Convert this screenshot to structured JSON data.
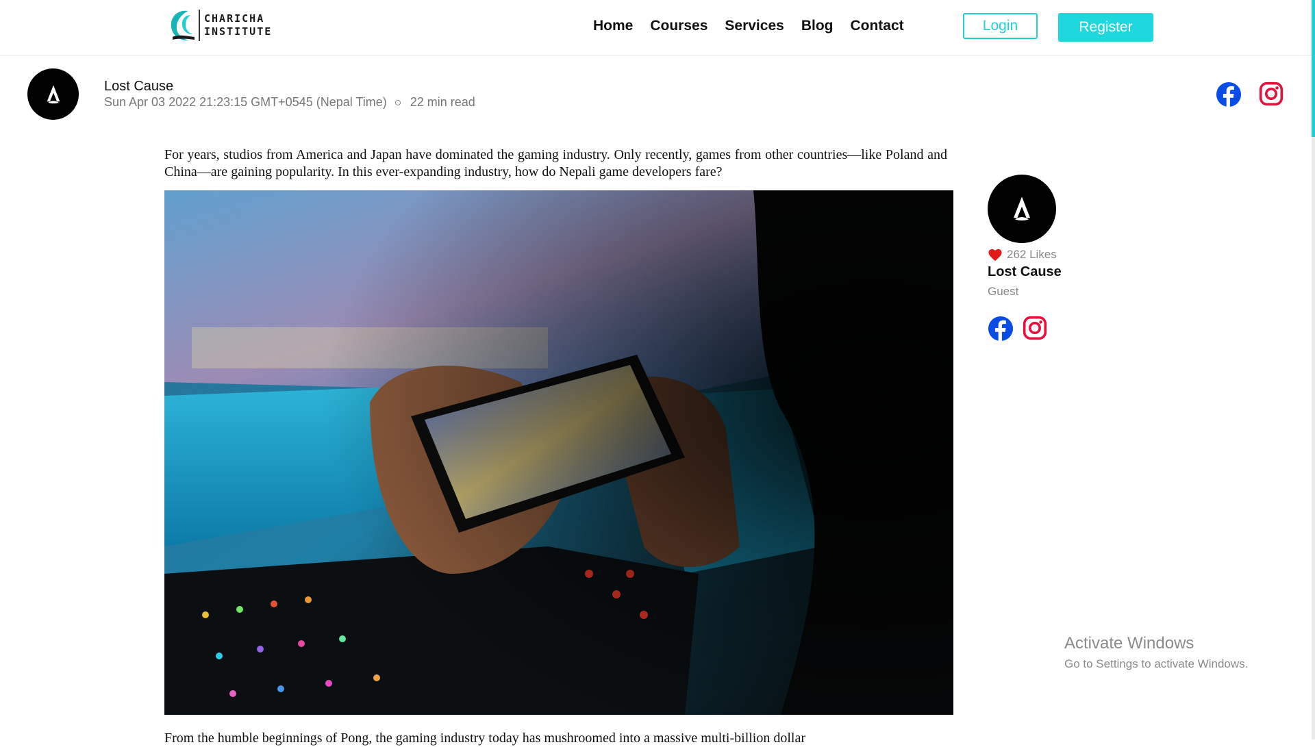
{
  "brand": {
    "line1": "CHARICHA",
    "line2": "INSTITUTE",
    "accent": "#1fd8de"
  },
  "nav": {
    "items": [
      "Home",
      "Courses",
      "Services",
      "Blog",
      "Contact"
    ]
  },
  "auth": {
    "login_label": "Login",
    "register_label": "Register"
  },
  "post": {
    "author": "Lost Cause",
    "date": "Sun Apr 03 2022 21:23:15 GMT+0545 (Nepal Time)",
    "read_time": "22 min read",
    "intro": "For years, studios from America and Japan have dominated the gaming industry. Only recently, games from other countries—like Poland and China—are gaining popularity. In this ever-expanding industry, how do Nepali game developers fare?",
    "next_paragraph_start": "From the humble beginnings of Pong, the gaming industry today has mushroomed into a massive multi-billion dollar"
  },
  "sidebar": {
    "likes": "262 Likes",
    "name": "Lost Cause",
    "role": "Guest"
  },
  "icons": {
    "facebook": "facebook-icon",
    "instagram": "instagram-icon",
    "facebook_color": "#1877f2",
    "instagram_color": "#e1306c",
    "heart_color": "#e02020"
  },
  "watermark": {
    "title": "Activate Windows",
    "subtitle": "Go to Settings to activate Windows."
  }
}
